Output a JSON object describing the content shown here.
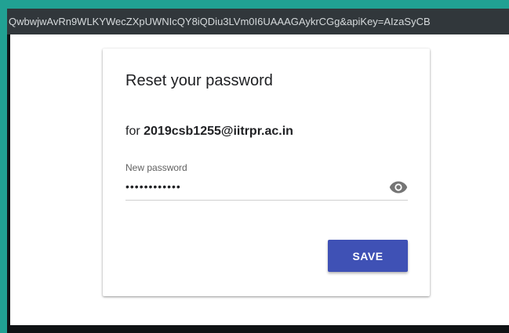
{
  "browser": {
    "url": "QwbwjwAvRn9WLKYWecZXpUWNIcQY8iQDiu3LVm0I6UAAAGAykrCGg&apiKey=AIzaSyCB"
  },
  "reset_form": {
    "title": "Reset your password",
    "for_prefix": "for",
    "email": "2019csb1255@iitrpr.ac.in",
    "new_password_label": "New password",
    "new_password_value": "••••••••••••",
    "toggle_icon": "eye-icon",
    "save_label": "SAVE"
  },
  "colors": {
    "page_border": "#21a193",
    "url_bar": "#31373b",
    "primary_button": "#3f51b5",
    "eye_icon": "#757575"
  }
}
